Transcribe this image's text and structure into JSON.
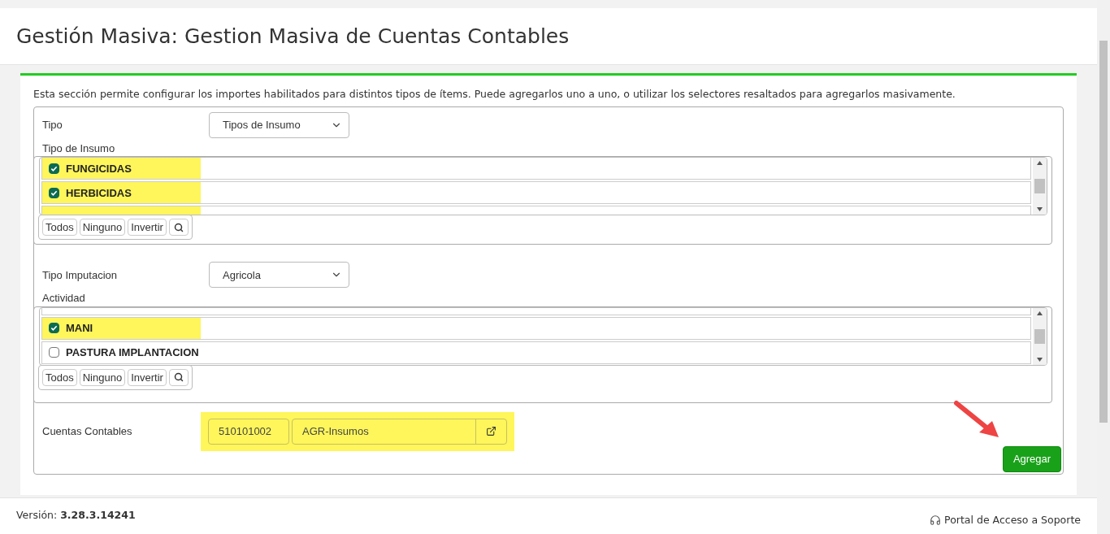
{
  "page_title": "Gestión Masiva: Gestion Masiva de Cuentas Contables",
  "description": "Esta sección permite configurar los importes habilitados para distintos tipos de ítems. Puede agregarlos uno a uno, o utilizar los selectores resaltados para agregarlos masivamente.",
  "tipo": {
    "label": "Tipo",
    "value": "Tipos de Insumo"
  },
  "tipo_insumo": {
    "label": "Tipo de Insumo",
    "items": [
      {
        "label": "FUNGICIDAS",
        "checked": true
      },
      {
        "label": "HERBICIDAS",
        "checked": true
      }
    ],
    "buttons": [
      "Todos",
      "Ninguno",
      "Invertir"
    ]
  },
  "tipo_imputacion": {
    "label": "Tipo Imputacion",
    "value": "Agricola"
  },
  "actividad": {
    "label": "Actividad",
    "items": [
      {
        "label": "MANI",
        "checked": true
      },
      {
        "label": "PASTURA IMPLANTACION",
        "checked": false
      }
    ],
    "buttons": [
      "Todos",
      "Ninguno",
      "Invertir"
    ]
  },
  "cuentas": {
    "label": "Cuentas Contables",
    "code": "510101002",
    "name": "AGR-Insumos"
  },
  "submit": "Agregar",
  "footer": {
    "version_label": "Versión:",
    "version": "3.28.3.14241",
    "support": "Portal de Acceso a Soporte"
  }
}
